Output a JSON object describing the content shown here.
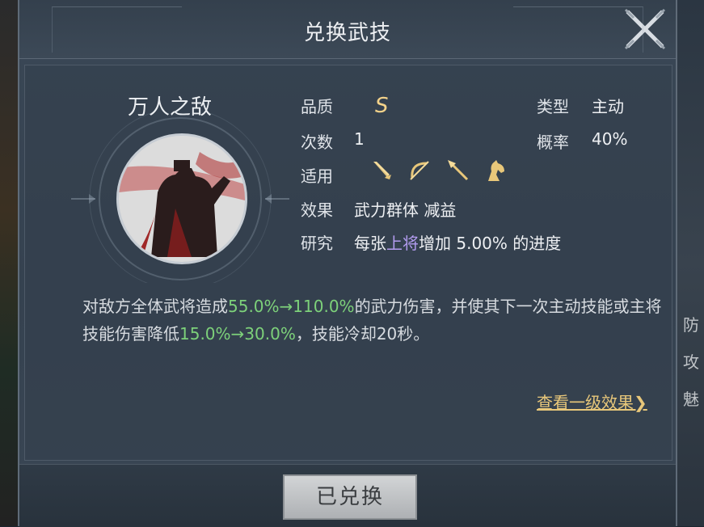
{
  "dialog": {
    "title": "兑换武技",
    "skill_name": "万人之敌",
    "info": {
      "quality_label": "品质",
      "quality_value": "S",
      "type_label": "类型",
      "type_value": "主动",
      "count_label": "次数",
      "count_value": "1",
      "rate_label": "概率",
      "rate_value": "40%",
      "applicable_label": "适用",
      "applicable_icons": [
        "sword-icon",
        "bow-icon",
        "spear-icon",
        "horse-icon"
      ],
      "effect_label": "效果",
      "effect_value": "武力群体 减益",
      "research_label": "研究",
      "research_prefix": "每张",
      "research_highlight": "上将",
      "research_suffix": "增加 5.00% 的进度"
    },
    "description": {
      "part1": "对敌方全体武将造成",
      "value1": "55.0%→110.0%",
      "part2": "的武力伤害，并使其下一次主动技能或主将技能伤害降低",
      "value2": "15.0%→30.0%",
      "part3": "，技能冷却20秒。"
    },
    "view_more": "查看一级效果❯",
    "button_label": "已兑换"
  },
  "background": {
    "side_chars": [
      "防",
      "攻",
      "魅"
    ]
  },
  "colors": {
    "highlight_green": "#7dd17a",
    "highlight_purple": "#b39cf0",
    "gold": "#e8c77a"
  }
}
